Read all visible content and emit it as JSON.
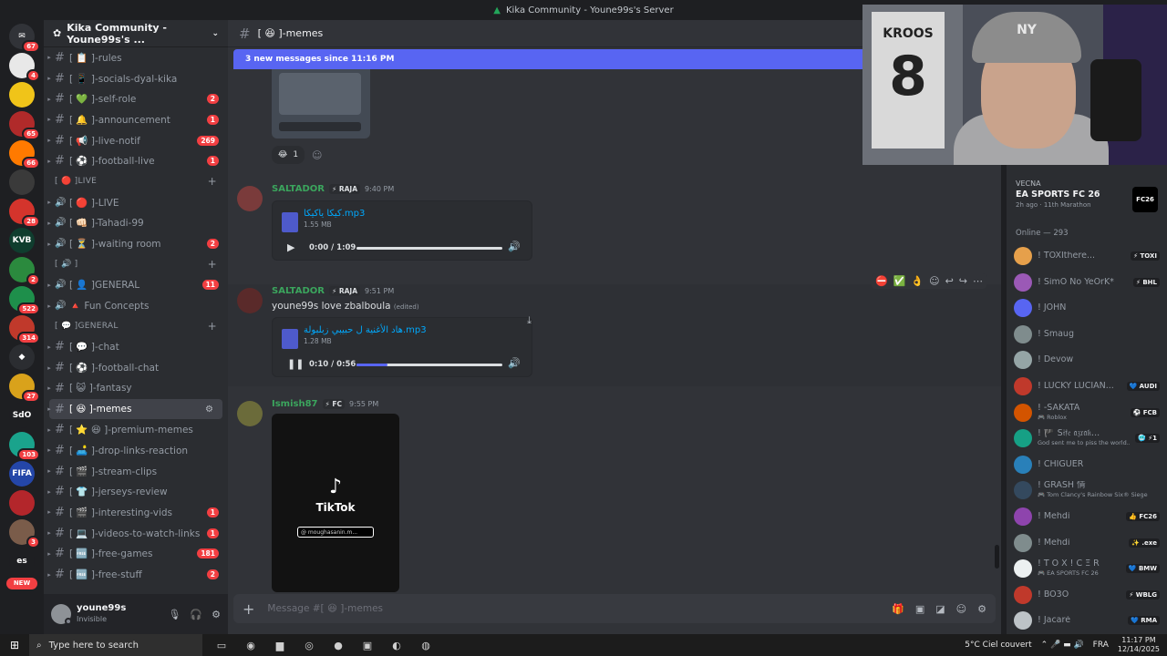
{
  "window": {
    "title": "Kika Community - Youne99s's Server"
  },
  "rail": [
    {
      "label": "",
      "badge": "67",
      "color": "#313338",
      "glyph": "✉"
    },
    {
      "label": "",
      "badge": "4",
      "color": "#e8e8e8"
    },
    {
      "label": "",
      "badge": "",
      "color": "#f0c419"
    },
    {
      "label": "",
      "badge": "65",
      "color": "#b02a2a"
    },
    {
      "label": "",
      "badge": "66",
      "color": "#ff7a00"
    },
    {
      "label": "",
      "badge": "",
      "color": "#3a3a3a"
    },
    {
      "label": "",
      "badge": "28",
      "color": "#d4342c"
    },
    {
      "label": "KVB",
      "badge": "",
      "color": "#0f3d2e"
    },
    {
      "label": "",
      "badge": "2",
      "color": "#2b8a3e"
    },
    {
      "label": "",
      "badge": "522",
      "color": "#1e8f4b"
    },
    {
      "label": "",
      "badge": "314",
      "color": "#c0392b"
    },
    {
      "label": "",
      "badge": "",
      "color": "#2b2d31",
      "glyph": "◆"
    },
    {
      "label": "",
      "badge": "27",
      "color": "#d9a21b"
    },
    {
      "label": "SdO",
      "badge": "",
      "color": "#1e1f22"
    },
    {
      "label": "",
      "badge": "103",
      "color": "#1aa38c"
    },
    {
      "label": "FIFA",
      "badge": "",
      "color": "#2446a8"
    },
    {
      "label": "",
      "badge": "",
      "color": "#b3262b"
    },
    {
      "label": "",
      "badge": "3",
      "color": "#7a5c4a"
    },
    {
      "label": "es",
      "badge": "",
      "color": "#1e1f22"
    }
  ],
  "rail_new": "NEW",
  "server": {
    "name": "Kika Community - Youne99s's ..."
  },
  "channels": [
    {
      "kind": "text",
      "name": "[ 📋 ]-rules",
      "badge": ""
    },
    {
      "kind": "text",
      "name": "[ 📱 ]-socials-dyal-kika",
      "badge": ""
    },
    {
      "kind": "text",
      "name": "[ 💚 ]-self-role",
      "badge": "2"
    },
    {
      "kind": "text",
      "name": "[ 🔔 ]-announcement",
      "badge": "1"
    },
    {
      "kind": "text",
      "name": "[ 📢 ]-live-notif",
      "badge": "269"
    },
    {
      "kind": "text",
      "name": "[ ⚽ ]-football-live",
      "badge": "1"
    },
    {
      "kind": "cat",
      "name": "[ 🔴 ]LIVE"
    },
    {
      "kind": "voice",
      "name": "[ 🔴 ]-LIVE",
      "badge": ""
    },
    {
      "kind": "voice",
      "name": "[ 👊🏻 ]-Tahadi-99",
      "badge": ""
    },
    {
      "kind": "voice",
      "name": "[ ⏳ ]-waiting room",
      "badge": "2"
    },
    {
      "kind": "cat",
      "name": "[ 🔊 ]"
    },
    {
      "kind": "voice",
      "name": "[ 👤 ]GENERAL",
      "badge": "11"
    },
    {
      "kind": "voice",
      "name": "🔺 Fun Concepts",
      "badge": ""
    },
    {
      "kind": "cat",
      "name": "[ 💬 ]GENERAL"
    },
    {
      "kind": "text",
      "name": "[ 💬 ]-chat",
      "badge": ""
    },
    {
      "kind": "text",
      "name": "[ ⚽ ]-football-chat",
      "badge": ""
    },
    {
      "kind": "text",
      "name": "[ 😺 ]-fantasy",
      "badge": ""
    },
    {
      "kind": "active",
      "name": "[ 😆 ]-memes",
      "badge": ""
    },
    {
      "kind": "text",
      "name": "[ ⭐ 😆 ]-premium-memes",
      "badge": ""
    },
    {
      "kind": "text",
      "name": "[ 🛋️ ]-drop-links-reaction",
      "badge": ""
    },
    {
      "kind": "text",
      "name": "[ 🎬 ]-stream-clips",
      "badge": ""
    },
    {
      "kind": "text",
      "name": "[ 👕 ]-jerseys-review",
      "badge": ""
    },
    {
      "kind": "text",
      "name": "[ 🎬 ]-interesting-vids",
      "badge": "1"
    },
    {
      "kind": "text",
      "name": "[ 💻 ]-videos-to-watch-links",
      "badge": "1"
    },
    {
      "kind": "text",
      "name": "[ 🆓 ]-free-games",
      "badge": "181"
    },
    {
      "kind": "text",
      "name": "[ 🆓 ]-free-stuff",
      "badge": "2"
    }
  ],
  "user": {
    "name": "youne99s",
    "status": "Invisible"
  },
  "channel_header": {
    "name": "[ 😆 ]-memes"
  },
  "new_messages": "3 new messages since 11:16 PM",
  "reaction": {
    "emoji": "😂",
    "count": "1"
  },
  "messages": [
    {
      "author": "SALTADOR",
      "tag": "⚡ RAJA",
      "time": "9:40 PM",
      "text": "",
      "edited": "",
      "file": {
        "name": "كيكا ياكيكا.mp3",
        "size": "1.55 MB",
        "time": "0:00 / 1:09",
        "progress": 0,
        "playing": false
      }
    },
    {
      "author": "SALTADOR",
      "tag": "⚡ RAJA",
      "time": "9:51 PM",
      "text": "youne99s love zbalboula",
      "edited": "(edited)",
      "file": {
        "name": "هاد الأغنية ل حبيبي زبلبولة.mp3",
        "size": "1.28 MB",
        "time": "0:10 / 0:56",
        "progress": 0.21,
        "playing": true
      }
    },
    {
      "author": "Ismish87",
      "tag": "⚡ FC",
      "time": "9:55 PM",
      "text": "",
      "edited": ""
    }
  ],
  "hover_tools": [
    "⛔",
    "✅",
    "👌",
    "☺",
    "↩",
    "↪",
    "⋯"
  ],
  "video": {
    "brand": "TikTok",
    "handle": "@ moughasanin.m..."
  },
  "composer": {
    "placeholder": "Message #[ 😆 ]-memes"
  },
  "activity": {
    "user": "VECNA",
    "game": "EA SPORTS FC 26",
    "ago": "2h ago",
    "extra": "11th Marathon",
    "icon_text": "FC26"
  },
  "online_label": "Online — 293",
  "members": [
    {
      "name": "! TOXIthere...",
      "sub": "",
      "tag": "⚡ TOXI",
      "color": "#e6a04b"
    },
    {
      "name": "! SimO No YeOrK*",
      "sub": "",
      "tag": "⚡ BHL",
      "color": "#9b59b6"
    },
    {
      "name": "! JOHN",
      "sub": "",
      "tag": "",
      "color": "#5865f2"
    },
    {
      "name": "! Smaug",
      "sub": "",
      "tag": "",
      "color": "#7f8c8d"
    },
    {
      "name": "! Devow",
      "sub": "",
      "tag": "",
      "color": "#95a5a6"
    },
    {
      "name": "! LUCKY LUCIAN...",
      "sub": "",
      "tag": "💙 AUDI",
      "color": "#c0392b"
    },
    {
      "name": "! -SAKATA",
      "sub": "🎮 Roblox",
      "tag": "⚽ FCB",
      "color": "#d35400"
    },
    {
      "name": "! 🏴 Ṡ𝔦𝔣𝔢 𝔞𝔷𝔯𝔞𝔨...",
      "sub": "God sent me to piss the world...",
      "tag": "🥶 ⚡1",
      "color": "#16a085"
    },
    {
      "name": "! CHIGUER",
      "sub": "",
      "tag": "",
      "color": "#2980b9"
    },
    {
      "name": "! GRASH 情",
      "sub": "🎮 Tom Clancy's Rainbow Six® Siege",
      "tag": "",
      "color": "#34495e"
    },
    {
      "name": "! Mehdi",
      "sub": "",
      "tag": "👍 FC26",
      "color": "#8e44ad"
    },
    {
      "name": "! Mehdi",
      "sub": "",
      "tag": "✨ .exe",
      "color": "#7f8c8d"
    },
    {
      "name": "! T O X ! C Ξ R",
      "sub": "🎮 EA SPORTS FC 26",
      "tag": "💙 BMW",
      "color": "#ecf0f1"
    },
    {
      "name": "! BO3O",
      "sub": "",
      "tag": "⚡ WBLG",
      "color": "#c0392b"
    },
    {
      "name": "! Jacaré",
      "sub": "",
      "tag": "💙 RMA",
      "color": "#bdc3c7"
    }
  ],
  "taskbar": {
    "search": "Type here to search",
    "weather": "5°C  Ciel couvert",
    "lang": "FRA",
    "time": "11:17 PM",
    "date": "12/14/2025"
  },
  "cam": {
    "jersey": "KROOS",
    "number": "8",
    "cap": "NY"
  }
}
